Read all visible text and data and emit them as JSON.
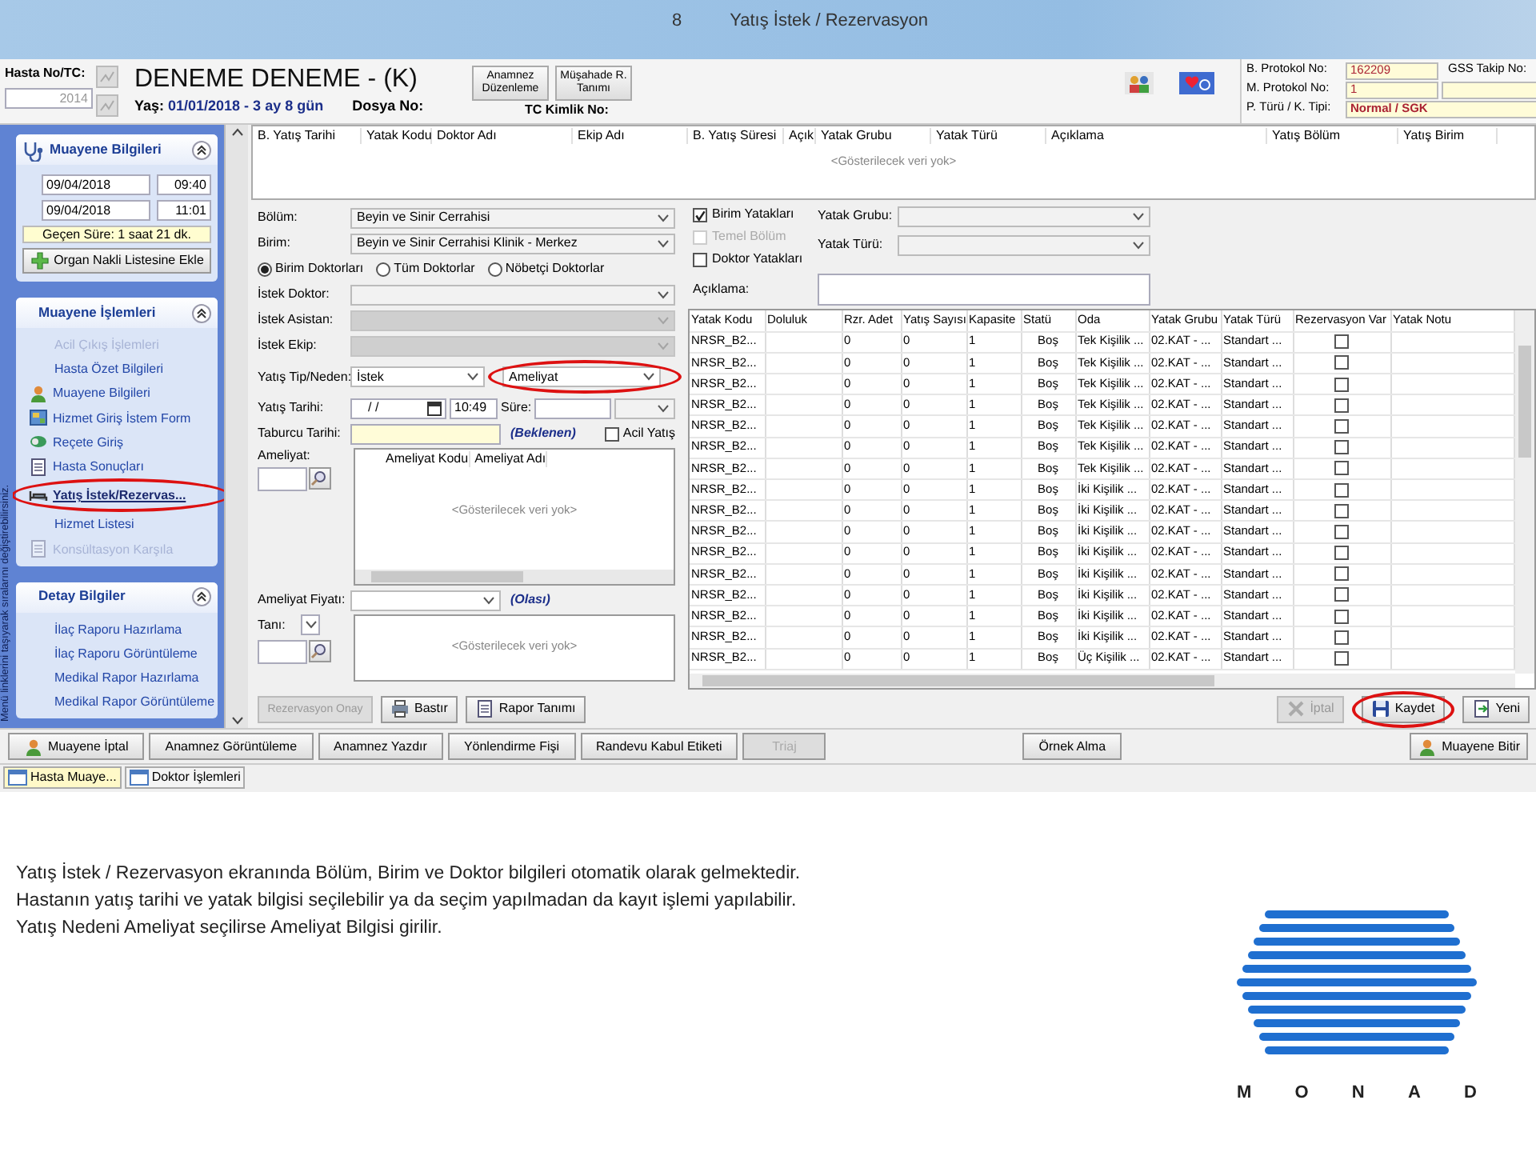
{
  "slide": {
    "number": "8",
    "title": "Yatış İstek / Rezervasyon"
  },
  "header": {
    "hasta_label": "Hasta No/TC:",
    "hasta_no": "2014",
    "patient_name": "DENEME DENEME - (K)",
    "age_label": "Yaş:",
    "age": "01/01/2018 - 3 ay 8 gün",
    "dosya_label": "Dosya No:",
    "tc_label": "TC Kimlik No:",
    "buttons": [
      {
        "label": "Anamnez Düzenleme"
      },
      {
        "label": "Müşahade R. Tanımı"
      }
    ],
    "protocol": [
      {
        "label": "B. Protokol No:",
        "value": "162209"
      },
      {
        "label": "M. Protokol No:",
        "value": "1"
      },
      {
        "label": "P. Türü / K. Tipi:",
        "value": "Normal / SGK"
      }
    ],
    "gss_label": "GSS Takip No:"
  },
  "sidebar": {
    "hint": "Menü linklerini taşıyarak sıralarını değiştirebilirsiniz.",
    "visit": {
      "title": "Muayene Bilgileri",
      "start_date": "09/04/2018",
      "start_time": "09:40",
      "end_date": "09/04/2018",
      "end_time": "11:01",
      "elapsed": "Geçen Süre: 1 saat 21 dk.",
      "button": "Organ Nakli Listesine Ekle"
    },
    "sections": [
      {
        "title": "Muayene İşlemleri",
        "items": [
          {
            "label": "Acil Çıkış İşlemleri",
            "has_icon": false,
            "disabled": true,
            "selected": false,
            "highlighted": false
          },
          {
            "label": "Hasta Özet Bilgileri",
            "has_icon": false,
            "disabled": false,
            "selected": false,
            "highlighted": false
          },
          {
            "label": "Muayene Bilgileri",
            "has_icon": true,
            "disabled": false,
            "selected": false,
            "highlighted": false
          },
          {
            "label": "Hizmet Giriş İstem Form",
            "has_icon": true,
            "disabled": false,
            "selected": false,
            "highlighted": false
          },
          {
            "label": "Reçete Giriş",
            "has_icon": true,
            "disabled": false,
            "selected": false,
            "highlighted": false
          },
          {
            "label": "Hasta Sonuçları",
            "has_icon": true,
            "disabled": false,
            "selected": false,
            "highlighted": false
          },
          {
            "label": "Yatış İstek/Rezervas...",
            "has_icon": true,
            "disabled": false,
            "selected": true,
            "highlighted": true
          },
          {
            "label": "Hizmet Listesi",
            "has_icon": false,
            "disabled": false,
            "selected": false,
            "highlighted": false
          },
          {
            "label": "Konsültasyon Karşıla",
            "has_icon": true,
            "disabled": true,
            "selected": false,
            "highlighted": false
          }
        ]
      },
      {
        "title": "Detay Bilgiler",
        "items": [
          {
            "label": "İlaç Raporu Hazırlama",
            "has_icon": false,
            "disabled": false,
            "selected": false,
            "highlighted": false
          },
          {
            "label": "İlaç Raporu Görüntüleme",
            "has_icon": false,
            "disabled": false,
            "selected": false,
            "highlighted": false
          },
          {
            "label": "Medikal Rapor Hazırlama",
            "has_icon": false,
            "disabled": false,
            "selected": false,
            "highlighted": false
          },
          {
            "label": "Medikal Rapor Görüntüleme",
            "has_icon": false,
            "disabled": false,
            "selected": false,
            "highlighted": false
          }
        ]
      }
    ]
  },
  "history": {
    "columns": [
      "B. Yatış Tarihi",
      "Yatak Kodu",
      "Doktor Adı",
      "Ekip Adı",
      "B. Yatış Süresi",
      "Açık",
      "Yatak Grubu",
      "Yatak Türü",
      "Açıklama",
      "Yatış Bölüm",
      "Yatış Birim"
    ],
    "empty_text": "<Gösterilecek veri yok>"
  },
  "form": {
    "bolum": {
      "label": "Bölüm:",
      "value": "Beyin ve Sinir Cerrahisi"
    },
    "birim": {
      "label": "Birim:",
      "value": "Beyin ve Sinir Cerrahisi  Klinik - Merkez"
    },
    "doctor_filter": [
      {
        "label": "Birim Doktorları",
        "selected": true
      },
      {
        "label": "Tüm Doktorlar",
        "selected": false
      },
      {
        "label": "Nöbetçi Doktorlar",
        "selected": false
      }
    ],
    "selects": [
      {
        "label": "İstek Doktor:",
        "disabled": false
      },
      {
        "label": "İstek Asistan:",
        "disabled": true
      },
      {
        "label": "İstek Ekip:",
        "disabled": true
      }
    ],
    "yatis_tip": {
      "label": "Yatış Tip/Neden:",
      "type": "İstek",
      "reason": "Ameliyat",
      "highlighted": true
    },
    "yatis_tarihi": {
      "label": "Yatış Tarihi:",
      "date": "/ /",
      "time": "10:49",
      "sure_label": "Süre:"
    },
    "taburcu": {
      "label": "Taburcu Tarihi:",
      "note": "(Beklenen)",
      "acil_label": "Acil Yatış",
      "acil_checked": false
    },
    "ameliyat": {
      "label": "Ameliyat:",
      "columns": [
        "Ameliyat Kodu",
        "Ameliyat Adı"
      ],
      "empty_text": "<Gösterilecek veri yok>"
    },
    "fiyat": {
      "label": "Ameliyat Fiyatı:",
      "note": "(Olası)"
    },
    "tani": {
      "label": "Tanı:",
      "empty_text": "<Gösterilecek veri yok>"
    }
  },
  "beds": {
    "filters": [
      {
        "label": "Birim Yatakları",
        "checked": true,
        "disabled": false
      },
      {
        "label": "Temel Bölüm",
        "checked": false,
        "disabled": true
      },
      {
        "label": "Doktor Yatakları",
        "checked": false,
        "disabled": false
      }
    ],
    "grup_label": "Yatak Grubu:",
    "tur_label": "Yatak Türü:",
    "aciklama_label": "Açıklama:",
    "columns": [
      "Yatak Kodu",
      "Doluluk",
      "Rzr. Adet",
      "Yatış Sayısı",
      "Kapasite",
      "Statü",
      "Oda",
      "Yatak Grubu",
      "Yatak Türü",
      "Rezervasyon Var",
      "Yatak Notu"
    ],
    "rows": [
      {
        "code": "NRSR_B2...",
        "rzr": "0",
        "yatis": "0",
        "kapasite": "1",
        "statu": "Boş",
        "oda": "Tek Kişilik ...",
        "grup": "02.KAT - ...",
        "tur": "Standart ...",
        "reserved": false
      },
      {
        "code": "NRSR_B2...",
        "rzr": "0",
        "yatis": "0",
        "kapasite": "1",
        "statu": "Boş",
        "oda": "Tek Kişilik ...",
        "grup": "02.KAT - ...",
        "tur": "Standart ...",
        "reserved": false
      },
      {
        "code": "NRSR_B2...",
        "rzr": "0",
        "yatis": "0",
        "kapasite": "1",
        "statu": "Boş",
        "oda": "Tek Kişilik ...",
        "grup": "02.KAT - ...",
        "tur": "Standart ...",
        "reserved": false
      },
      {
        "code": "NRSR_B2...",
        "rzr": "0",
        "yatis": "0",
        "kapasite": "1",
        "statu": "Boş",
        "oda": "Tek Kişilik ...",
        "grup": "02.KAT - ...",
        "tur": "Standart ...",
        "reserved": false
      },
      {
        "code": "NRSR_B2...",
        "rzr": "0",
        "yatis": "0",
        "kapasite": "1",
        "statu": "Boş",
        "oda": "Tek Kişilik ...",
        "grup": "02.KAT - ...",
        "tur": "Standart ...",
        "reserved": false
      },
      {
        "code": "NRSR_B2...",
        "rzr": "0",
        "yatis": "0",
        "kapasite": "1",
        "statu": "Boş",
        "oda": "Tek Kişilik ...",
        "grup": "02.KAT - ...",
        "tur": "Standart ...",
        "reserved": false
      },
      {
        "code": "NRSR_B2...",
        "rzr": "0",
        "yatis": "0",
        "kapasite": "1",
        "statu": "Boş",
        "oda": "Tek Kişilik ...",
        "grup": "02.KAT - ...",
        "tur": "Standart ...",
        "reserved": false
      },
      {
        "code": "NRSR_B2...",
        "rzr": "0",
        "yatis": "0",
        "kapasite": "1",
        "statu": "Boş",
        "oda": "İki Kişilik ...",
        "grup": "02.KAT - ...",
        "tur": "Standart ...",
        "reserved": false
      },
      {
        "code": "NRSR_B2...",
        "rzr": "0",
        "yatis": "0",
        "kapasite": "1",
        "statu": "Boş",
        "oda": "İki Kişilik ...",
        "grup": "02.KAT - ...",
        "tur": "Standart ...",
        "reserved": false
      },
      {
        "code": "NRSR_B2...",
        "rzr": "0",
        "yatis": "0",
        "kapasite": "1",
        "statu": "Boş",
        "oda": "İki Kişilik ...",
        "grup": "02.KAT - ...",
        "tur": "Standart ...",
        "reserved": false
      },
      {
        "code": "NRSR_B2...",
        "rzr": "0",
        "yatis": "0",
        "kapasite": "1",
        "statu": "Boş",
        "oda": "İki Kişilik ...",
        "grup": "02.KAT - ...",
        "tur": "Standart ...",
        "reserved": false
      },
      {
        "code": "NRSR_B2...",
        "rzr": "0",
        "yatis": "0",
        "kapasite": "1",
        "statu": "Boş",
        "oda": "İki Kişilik ...",
        "grup": "02.KAT - ...",
        "tur": "Standart ...",
        "reserved": false
      },
      {
        "code": "NRSR_B2...",
        "rzr": "0",
        "yatis": "0",
        "kapasite": "1",
        "statu": "Boş",
        "oda": "İki Kişilik ...",
        "grup": "02.KAT - ...",
        "tur": "Standart ...",
        "reserved": false
      },
      {
        "code": "NRSR_B2...",
        "rzr": "0",
        "yatis": "0",
        "kapasite": "1",
        "statu": "Boş",
        "oda": "İki Kişilik ...",
        "grup": "02.KAT - ...",
        "tur": "Standart ...",
        "reserved": false
      },
      {
        "code": "NRSR_B2...",
        "rzr": "0",
        "yatis": "0",
        "kapasite": "1",
        "statu": "Boş",
        "oda": "İki Kişilik ...",
        "grup": "02.KAT - ...",
        "tur": "Standart ...",
        "reserved": false
      },
      {
        "code": "NRSR_B2...",
        "rzr": "0",
        "yatis": "0",
        "kapasite": "1",
        "statu": "Boş",
        "oda": "Üç Kişilik ...",
        "grup": "02.KAT - ...",
        "tur": "Standart ...",
        "reserved": false
      }
    ]
  },
  "form_actions": {
    "left": [
      {
        "label": "Rezervasyon Onay",
        "has_icon": false,
        "disabled": true,
        "highlighted": false
      },
      {
        "label": "Bastır",
        "has_icon": true,
        "disabled": false,
        "highlighted": false
      },
      {
        "label": "Rapor Tanımı",
        "has_icon": true,
        "disabled": false,
        "highlighted": false
      }
    ],
    "right": [
      {
        "label": "İptal",
        "has_icon": true,
        "disabled": true,
        "highlighted": false
      },
      {
        "label": "Kaydet",
        "has_icon": true,
        "disabled": false,
        "highlighted": true
      },
      {
        "label": "Yeni",
        "has_icon": true,
        "disabled": false,
        "highlighted": false
      }
    ]
  },
  "toolbar": {
    "buttons": [
      {
        "label": "Muayene İptal",
        "has_icon": true,
        "disabled": false
      },
      {
        "label": "Anamnez Görüntüleme",
        "has_icon": false,
        "disabled": false
      },
      {
        "label": "Anamnez Yazdır",
        "has_icon": false,
        "disabled": false
      },
      {
        "label": "Yönlendirme Fişi",
        "has_icon": false,
        "disabled": false
      },
      {
        "label": "Randevu Kabul Etiketi",
        "has_icon": false,
        "disabled": false
      },
      {
        "label": "Triaj",
        "has_icon": false,
        "disabled": true
      }
    ],
    "middle_button": {
      "label": "Örnek Alma"
    },
    "end_button": {
      "label": "Muayene Bitir"
    }
  },
  "taskbar": [
    {
      "label": "Hasta Muaye...",
      "selected": true
    },
    {
      "label": "Doktor İşlemleri",
      "selected": false
    }
  ],
  "caption": [
    "Yatış İstek / Rezervasyon ekranında Bölüm, Birim ve Doktor bilgileri otomatik olarak gelmektedir.",
    "Hastanın yatış tarihi ve yatak bilgisi seçilebilir ya da seçim yapılmadan da kayıt işlemi yapılabilir.",
    "Yatış Nedeni Ameliyat seçilirse  Ameliyat Bilgisi  girilir."
  ],
  "logo": {
    "letters": [
      "M",
      "O",
      "N",
      "A",
      "D"
    ]
  }
}
